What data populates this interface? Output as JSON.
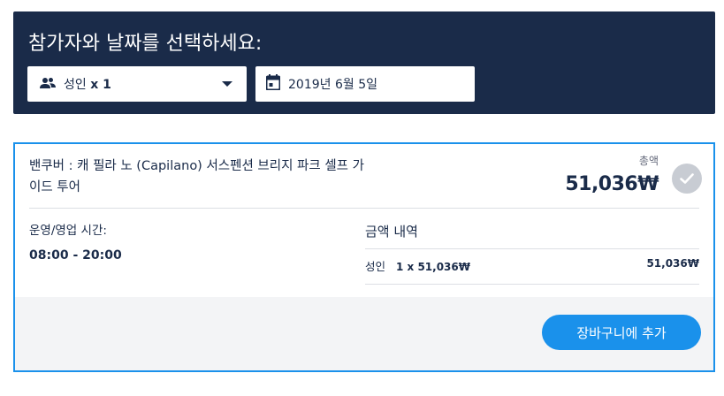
{
  "selector": {
    "title": "참가자와 날짜를 선택하세요:",
    "participants": {
      "label": "성인",
      "count": "x 1"
    },
    "date": {
      "value": "2019년 6월 5일"
    }
  },
  "offer": {
    "title": "밴쿠버 : 캐 필라 노 (Capilano) 서스펜션 브리지 파크 셀프 가이드 투어",
    "total_label": "총액",
    "total_price": "51,036₩",
    "hours_label": "운영/영업 시간:",
    "hours_value": "08:00 - 20:00",
    "breakdown_title": "금액 내역",
    "breakdown": [
      {
        "label": "성인",
        "qty": "1 x 51,036₩",
        "amount": "51,036₩"
      }
    ],
    "add_to_cart_label": "장바구니에 추가"
  },
  "colors": {
    "navy": "#1a2b49",
    "accent": "#1a91eb"
  },
  "icons": {
    "participants": "users-icon",
    "date": "calendar-icon",
    "dropdown": "chevron-down-icon",
    "selected": "check-icon"
  }
}
